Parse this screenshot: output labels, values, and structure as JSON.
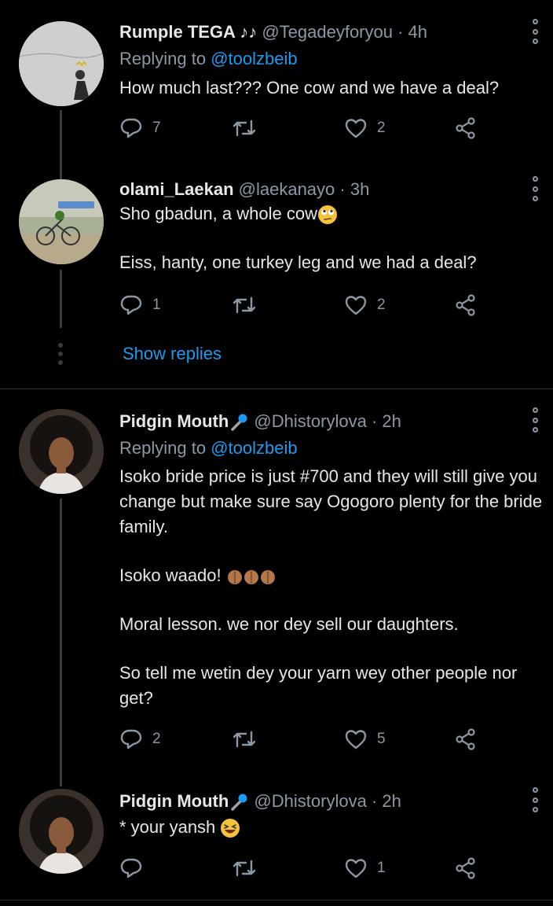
{
  "tweets": [
    {
      "name": "Rumple TEGA ♪♪",
      "handle": "@Tegadeyforyou",
      "time": "· 4h",
      "replying_prefix": "Replying to",
      "replying_to": "@toolzbeib",
      "text": "How much last??? One cow and we have a deal?",
      "replies": "7",
      "likes": "2"
    },
    {
      "name": "olami_Laekan",
      "handle": "@laekanayo",
      "time": "· 3h",
      "line1": "Sho gbadun, a whole cow",
      "line2": "Eiss, hanty, one turkey leg and we had a deal?",
      "replies": "1",
      "likes": "2"
    },
    {
      "name": "Pidgin Mouth",
      "handle": "@Dhistorylova",
      "time": "· 2h",
      "replying_prefix": "Replying to",
      "replying_to": "@toolzbeib",
      "para1": "Isoko bride price is just #700 and they will still give you change but make sure say Ogogoro plenty for the bride family.",
      "para2": "Isoko waado!",
      "para3": "Moral lesson. we nor dey sell our daughters.",
      "para4": "So tell me wetin dey your yarn wey other people nor get?",
      "replies": "2",
      "likes": "5"
    },
    {
      "name": "Pidgin Mouth",
      "handle": "@Dhistorylova",
      "time": "· 2h",
      "text": "* your yansh",
      "likes": "1"
    }
  ],
  "show_replies": "Show replies",
  "icons": {
    "reply": "reply-icon",
    "retweet": "retweet-icon",
    "like": "heart-icon",
    "share": "share-icon",
    "more": "more-vertical-icon"
  },
  "colors": {
    "background": "#000000",
    "link": "#1d9bf0",
    "secondary": "#8b98a5"
  }
}
